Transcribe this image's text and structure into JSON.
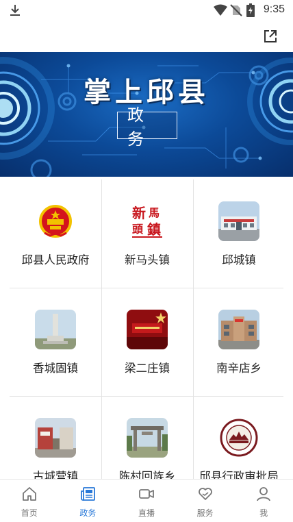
{
  "status_bar": {
    "time": "9:35"
  },
  "banner": {
    "title": "掌上邱县",
    "subtitle": "政务"
  },
  "grid": {
    "items": [
      {
        "label": "邱县人民政府",
        "icon": "national-emblem-icon"
      },
      {
        "label": "新马头镇",
        "icon": "xinmatou-logo"
      },
      {
        "label": "邱城镇",
        "icon": "building-photo"
      },
      {
        "label": "香城固镇",
        "icon": "monument-photo"
      },
      {
        "label": "梁二庄镇",
        "icon": "red-stage-photo"
      },
      {
        "label": "南辛店乡",
        "icon": "government-building-photo"
      },
      {
        "label": "古城营镇",
        "icon": "gate-photo"
      },
      {
        "label": "陈村回族乡",
        "icon": "archway-photo"
      },
      {
        "label": "邱县行政审批局",
        "icon": "approval-bureau-logo"
      }
    ]
  },
  "tabbar": {
    "items": [
      {
        "label": "首页",
        "icon": "home-icon",
        "active": false
      },
      {
        "label": "政务",
        "icon": "newspaper-icon",
        "active": true
      },
      {
        "label": "直播",
        "icon": "video-icon",
        "active": false
      },
      {
        "label": "服务",
        "icon": "heart-hands-icon",
        "active": false
      },
      {
        "label": "我",
        "icon": "user-icon",
        "active": false
      }
    ],
    "active_color": "#2878d8",
    "inactive_color": "#777777"
  }
}
